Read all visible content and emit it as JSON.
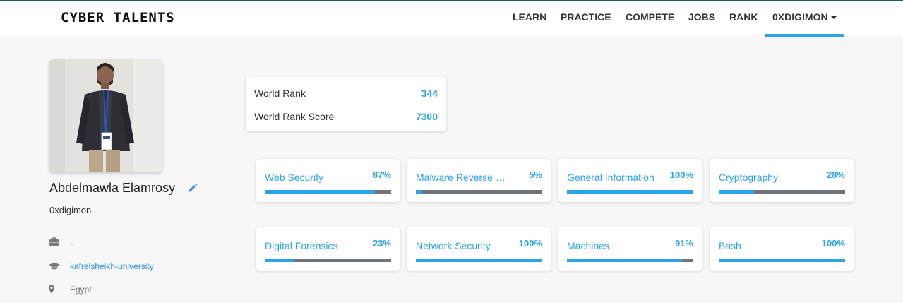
{
  "navbar": {
    "brand": "CYBER TALENTS",
    "items": [
      "LEARN",
      "PRACTICE",
      "COMPETE",
      "JOBS",
      "RANK"
    ],
    "user_menu": "0XDIGIMON"
  },
  "profile": {
    "name": "Abdelmawla Elamrosy",
    "username": "0xdigimon",
    "work": "..",
    "university": "kafrelsheikh-university",
    "country": "Egypt"
  },
  "ranks": [
    {
      "label": "World Rank",
      "value": "344"
    },
    {
      "label": "World Rank Score",
      "value": "7300"
    }
  ],
  "categories": [
    {
      "name": "Web Security",
      "percent": "87%",
      "progress": 0.87
    },
    {
      "name": "Malware Reverse Engineering",
      "percent": "5%",
      "progress": 0.05
    },
    {
      "name": "General Information",
      "percent": "100%",
      "progress": 1.0
    },
    {
      "name": "Cryptography",
      "percent": "28%",
      "progress": 0.28
    },
    {
      "name": "Digital Forensics",
      "percent": "23%",
      "progress": 0.23
    },
    {
      "name": "Network Security",
      "percent": "100%",
      "progress": 1.0
    },
    {
      "name": "Machines",
      "percent": "91%",
      "progress": 0.91
    },
    {
      "name": "Bash",
      "percent": "100%",
      "progress": 1.0
    }
  ],
  "colors": {
    "accent": "#2ba3e6",
    "bar_track": "#6e747a",
    "nav_border": "#1c5d7c"
  },
  "icons": {
    "edit": "pencil-icon",
    "work": "briefcase-icon",
    "education": "graduation-cap-icon",
    "location": "map-marker-icon"
  }
}
